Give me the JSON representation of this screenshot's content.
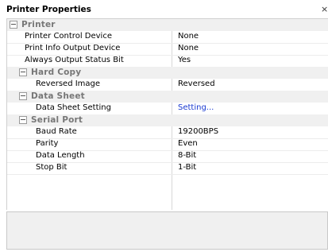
{
  "window": {
    "title": "Printer Properties",
    "close_glyph": "×"
  },
  "categories": [
    {
      "label": "Printer"
    },
    {
      "label": "Hard Copy"
    },
    {
      "label": "Data Sheet"
    },
    {
      "label": "Serial Port"
    }
  ],
  "properties": [
    {
      "name": "Printer Control Device",
      "value": "None"
    },
    {
      "name": "Print Info Output Device",
      "value": "None"
    },
    {
      "name": "Always Output Status Bit",
      "value": "Yes"
    },
    {
      "name": "Reversed Image",
      "value": "Reversed"
    },
    {
      "name": "Data Sheet Setting",
      "value": "Setting..."
    },
    {
      "name": "Baud Rate",
      "value": "19200BPS"
    },
    {
      "name": "Parity",
      "value": "Even"
    },
    {
      "name": "Data Length",
      "value": "8-Bit"
    },
    {
      "name": "Stop Bit",
      "value": "1-Bit"
    }
  ],
  "colors": {
    "category_bg": "#f0f0f0",
    "category_text": "#777777",
    "link": "#1a3ad1",
    "description_bg": "#f0f0f0"
  }
}
